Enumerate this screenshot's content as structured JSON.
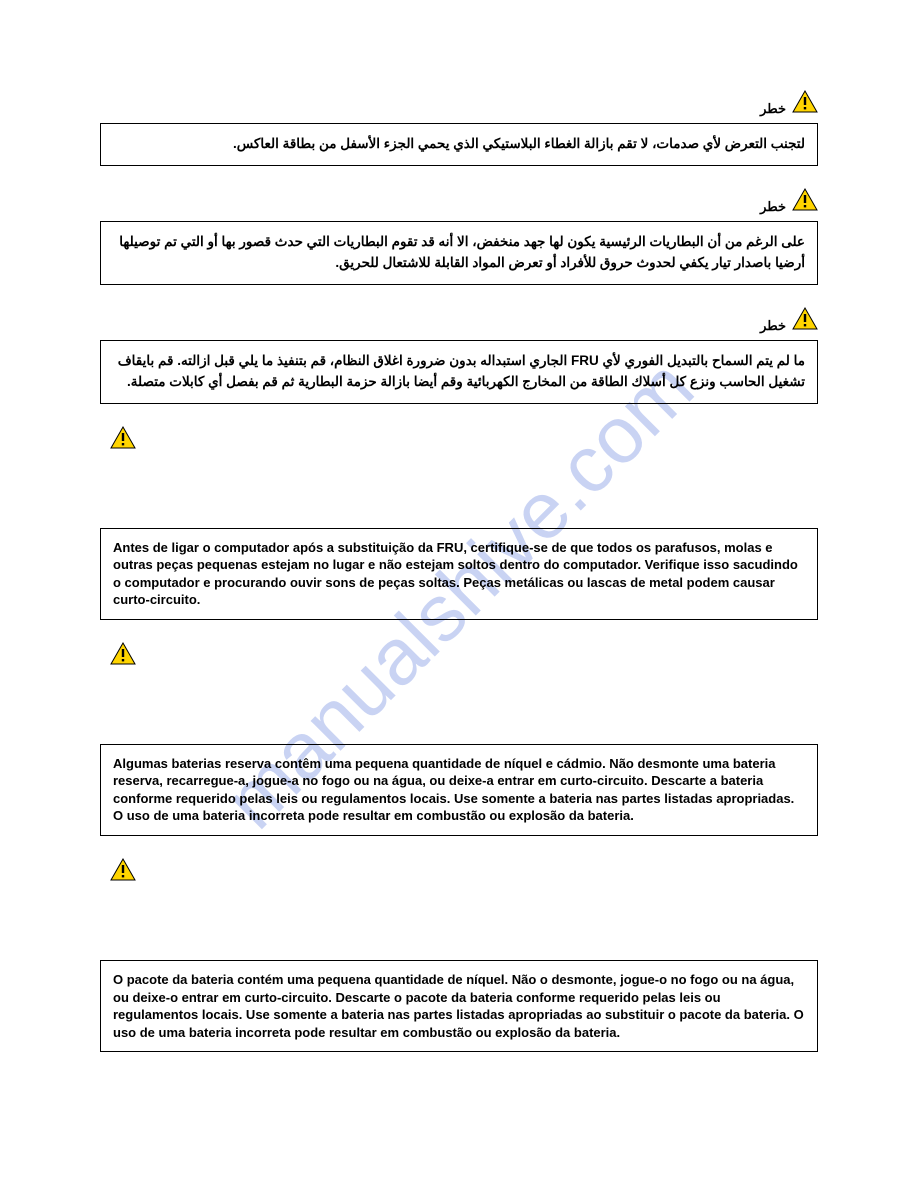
{
  "watermark": "manualshive.com",
  "sections": [
    {
      "danger_label": "خطر",
      "text": "لتجنب التعرض لأي صدمات، لا تقم بازالة الغطاء البلاستيكي الذي يحمي الجزء الأسفل من بطاقة العاكس."
    },
    {
      "danger_label": "خطر",
      "text": "على الرغم من أن البطاريات الرئيسية يكون لها جهد منخفض، الا أنه قد تقوم البطاريات التي حدث قصور بها أو التي تم توصيلها أرضيا باصدار تيار يكفي لحدوث حروق للأفراد أو تعرض المواد القابلة للاشتعال للحريق."
    },
    {
      "danger_label": "خطر",
      "text": "ما لم يتم السماح بالتبديل الفوري لأي FRU الجاري استبداله بدون ضرورة اغلاق النظام، قم بتنفيذ ما يلي قبل ازالته. قم بايقاف تشغيل الحاسب ونزع كل أسلاك الطاقة من المخارج الكهربائية وقم أيضا بازالة حزمة البطارية ثم قم بفصل أي كابلات متصلة."
    },
    {
      "text": "Antes de ligar o computador após a substituição da FRU, certifique-se de que todos os parafusos, molas e outras peças pequenas estejam no lugar e não estejam soltos dentro do computador. Verifique isso sacudindo o computador e procurando ouvir sons de peças soltas. Peças metálicas ou lascas de metal podem causar curto-circuito."
    },
    {
      "text": "Algumas baterias reserva contêm uma pequena quantidade de níquel e cádmio. Não desmonte uma bateria reserva, recarregue-a, jogue-a no fogo ou na água, ou deixe-a entrar em curto-circuito. Descarte a bateria conforme requerido pelas leis ou regulamentos locais. Use somente a bateria nas partes listadas apropriadas. O uso de uma bateria incorreta pode resultar em combustão ou explosão da bateria."
    },
    {
      "text": "O pacote da bateria contém uma pequena quantidade de níquel. Não o desmonte, jogue-o no fogo ou na água, ou deixe-o entrar em curto-circuito. Descarte o pacote da bateria conforme requerido pelas leis ou regulamentos locais. Use somente a bateria nas partes listadas apropriadas ao substituir o pacote da bateria. O uso de uma bateria incorreta pode resultar em combustão ou explosão da bateria."
    }
  ]
}
